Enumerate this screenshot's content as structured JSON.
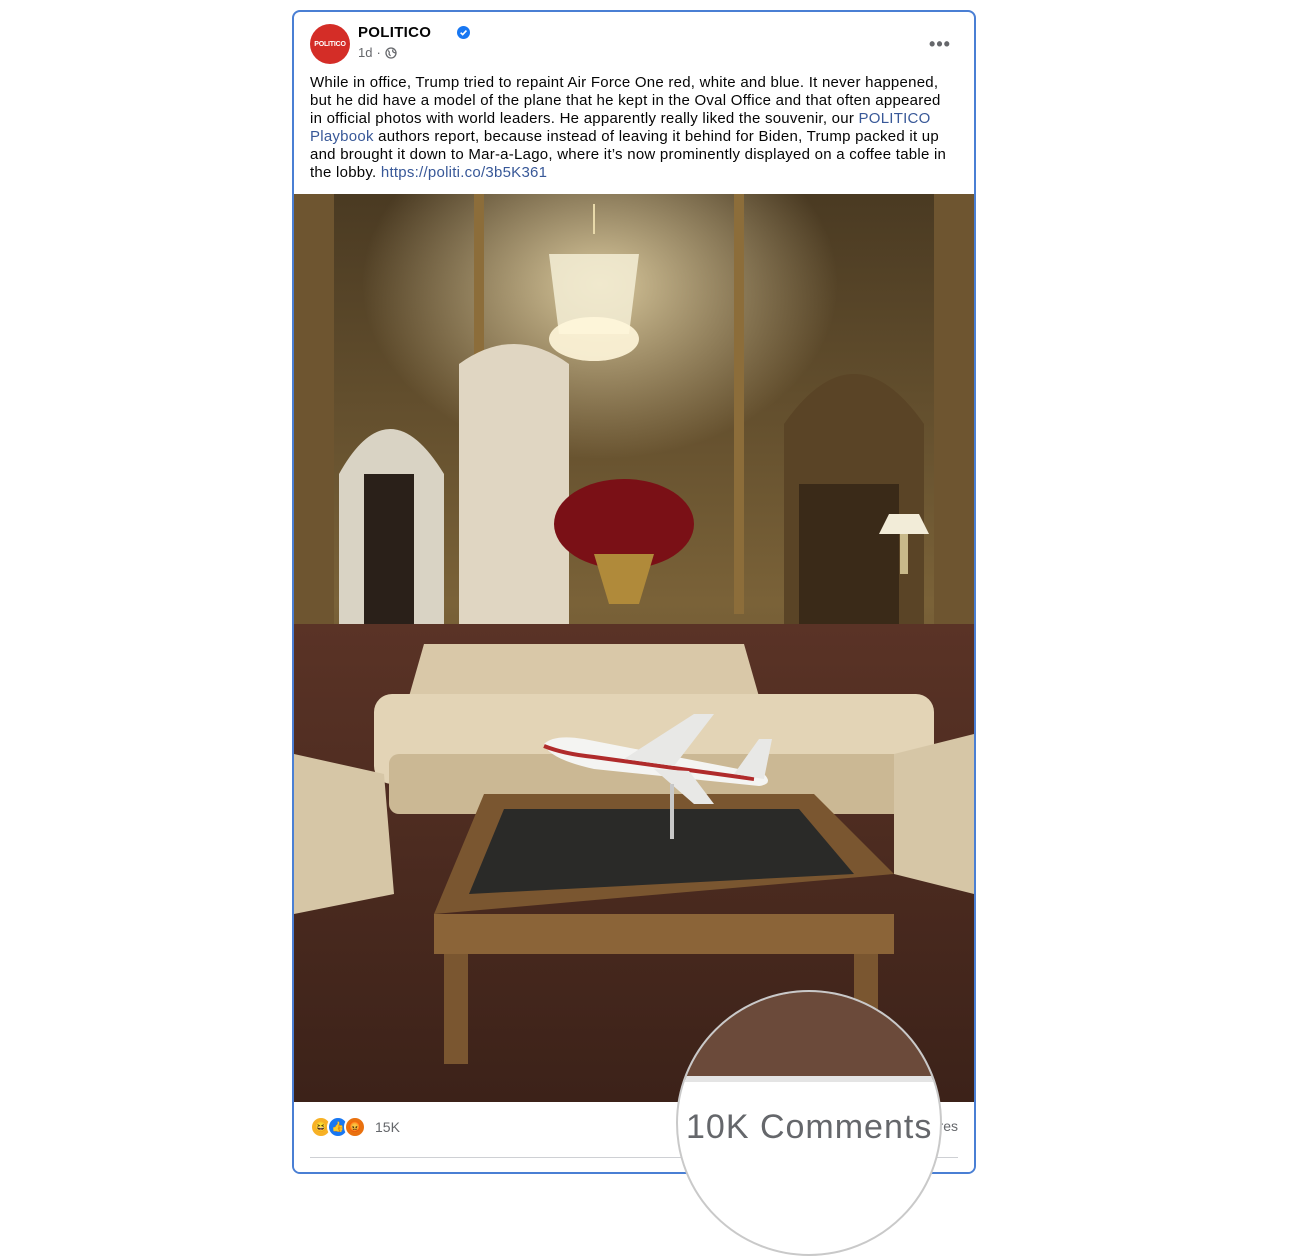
{
  "post": {
    "page_name": "POLITICO",
    "avatar_text": "POLITICO",
    "timestamp": "1d",
    "separator": "·",
    "more_label": "•••",
    "text_before": "While in office, Trump tried to repaint Air Force One red, white and blue. It never happened, but he did have a model of the plane that he kept in the Oval Office and that often appeared in official photos with world leaders. He apparently really liked the souvenir, our ",
    "link_text": "POLITICO Playbook",
    "text_middle": " authors report, because instead of leaving it behind for Biden, Trump packed it up and brought it down to Mar-a-Lago, where it’s now prominently displayed on a coffee table in the lobby. ",
    "url_text": "https://politi.co/3b5K361"
  },
  "footer": {
    "reaction_count": "15K",
    "shares_tail": "res"
  },
  "magnifier": {
    "comments_label": "10K Comments"
  },
  "colors": {
    "border": "#4a7fd4",
    "brand_red": "#d42d27",
    "link": "#385898",
    "secondary_text": "#65676b"
  }
}
